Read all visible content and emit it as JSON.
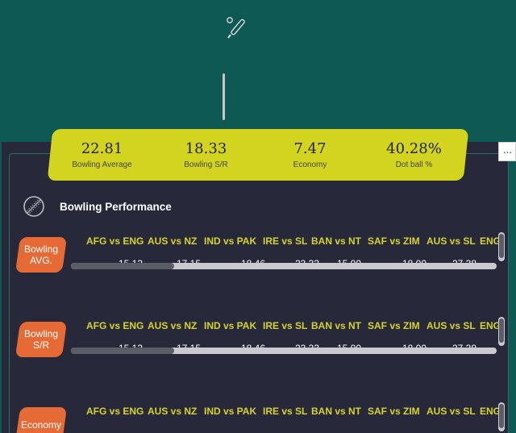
{
  "stats": [
    {
      "value": "22.81",
      "label": "Bowling Average"
    },
    {
      "value": "18.33",
      "label": "Bowling S/R"
    },
    {
      "value": "7.47",
      "label": "Economy"
    },
    {
      "value": "40.28%",
      "label": "Dot ball %"
    }
  ],
  "more_button": "···",
  "performance": {
    "title": "Bowling Performance",
    "matches": [
      "AFG vs ENG",
      "AUS vs NZ",
      "IND vs PAK",
      "IRE vs SL",
      "BAN vs NT",
      "SAF vs ZIM",
      "AUS vs SL",
      "ENG"
    ],
    "rows": [
      {
        "label": "Bowling AVG.",
        "values": [
          "15.13",
          "17.15",
          "18.46",
          "23.33",
          "15.00",
          "18.00",
          "27.38",
          ""
        ]
      },
      {
        "label": "Bowling S/R",
        "values": [
          "15.13",
          "17.15",
          "18.46",
          "23.33",
          "15.00",
          "18.00",
          "27.38",
          ""
        ]
      },
      {
        "label": "Economy",
        "values": [
          "",
          "",
          "",
          "",
          "",
          "",
          "",
          ""
        ]
      }
    ]
  },
  "colors": {
    "hero_bg": "#0e5954",
    "panel_bg": "#27293b",
    "stats_card": "#d2d41f",
    "badge": "#e56a35",
    "match_label": "#d7d32a"
  }
}
